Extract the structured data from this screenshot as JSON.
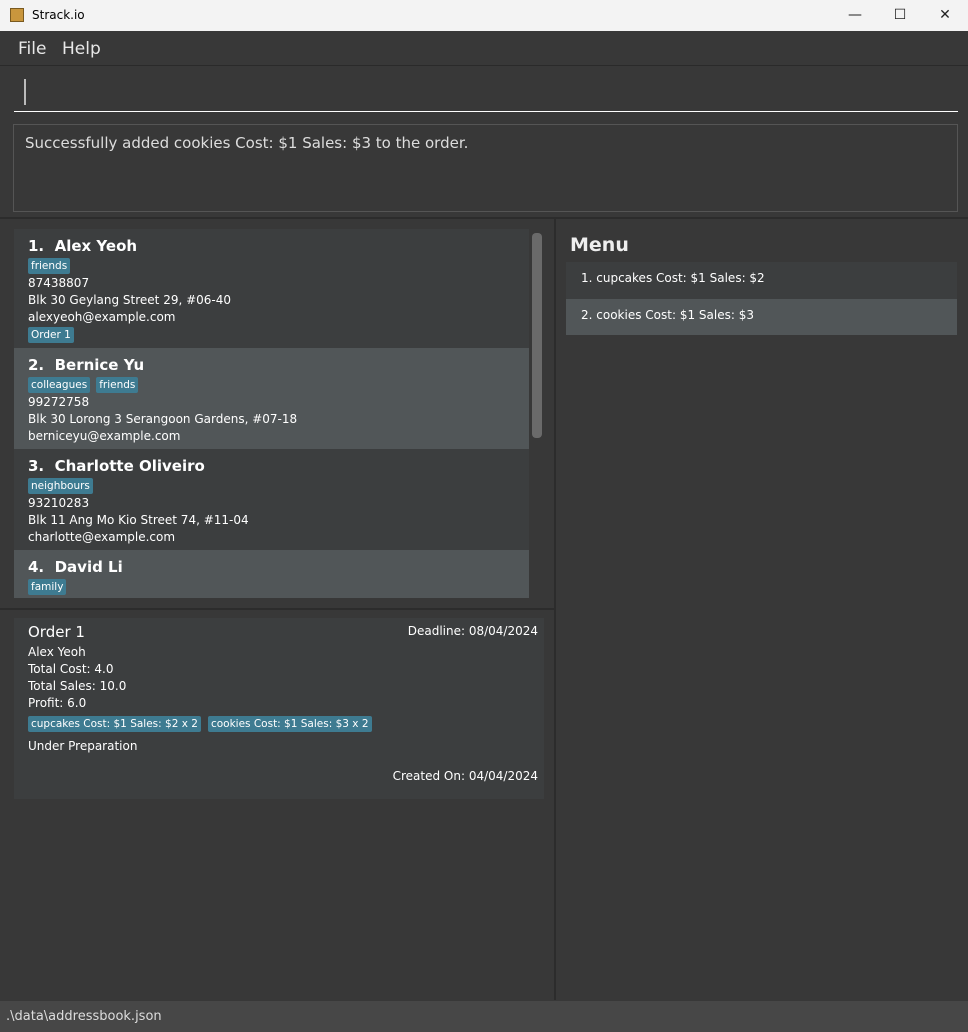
{
  "window": {
    "title": "Strack.io",
    "minimize": "—",
    "maximize": "☐",
    "close": "✕"
  },
  "menubar": [
    "File",
    "Help"
  ],
  "command": {
    "value": ""
  },
  "result": "Successfully added cookies Cost: $1 Sales: $3 to the order.",
  "persons": [
    {
      "index": "1.",
      "name": "Alex Yeoh",
      "tags": [
        "friends"
      ],
      "phone": "87438807",
      "address": "Blk 30 Geylang Street 29, #06-40",
      "email": "alexyeoh@example.com",
      "orders": [
        "Order 1"
      ]
    },
    {
      "index": "2.",
      "name": "Bernice Yu",
      "tags": [
        "colleagues",
        "friends"
      ],
      "phone": "99272758",
      "address": "Blk 30 Lorong 3 Serangoon Gardens, #07-18",
      "email": "berniceyu@example.com",
      "orders": []
    },
    {
      "index": "3.",
      "name": "Charlotte Oliveiro",
      "tags": [
        "neighbours"
      ],
      "phone": "93210283",
      "address": "Blk 11 Ang Mo Kio Street 74, #11-04",
      "email": "charlotte@example.com",
      "orders": []
    },
    {
      "index": "4.",
      "name": "David Li",
      "tags": [
        "family"
      ],
      "phone": "",
      "address": "",
      "email": "",
      "orders": []
    }
  ],
  "order": {
    "title": "Order 1",
    "deadline": "Deadline: 08/04/2024",
    "customer": "Alex Yeoh",
    "total_cost": "Total Cost: 4.0",
    "total_sales": "Total Sales: 10.0",
    "profit": "Profit: 6.0",
    "items": [
      "cupcakes Cost: $1 Sales: $2 x 2",
      "cookies Cost: $1 Sales: $3 x 2"
    ],
    "status": "Under Preparation",
    "created": "Created On: 04/04/2024"
  },
  "menu": {
    "title": "Menu",
    "items": [
      "1. cupcakes  Cost: $1  Sales: $2",
      "2. cookies  Cost: $1  Sales: $3"
    ]
  },
  "statusbar": ".\\data\\addressbook.json",
  "colors": {
    "tag": "#3e7b91",
    "background": "#383838",
    "card": "#3c3e3f",
    "card_selected": "#515658"
  }
}
